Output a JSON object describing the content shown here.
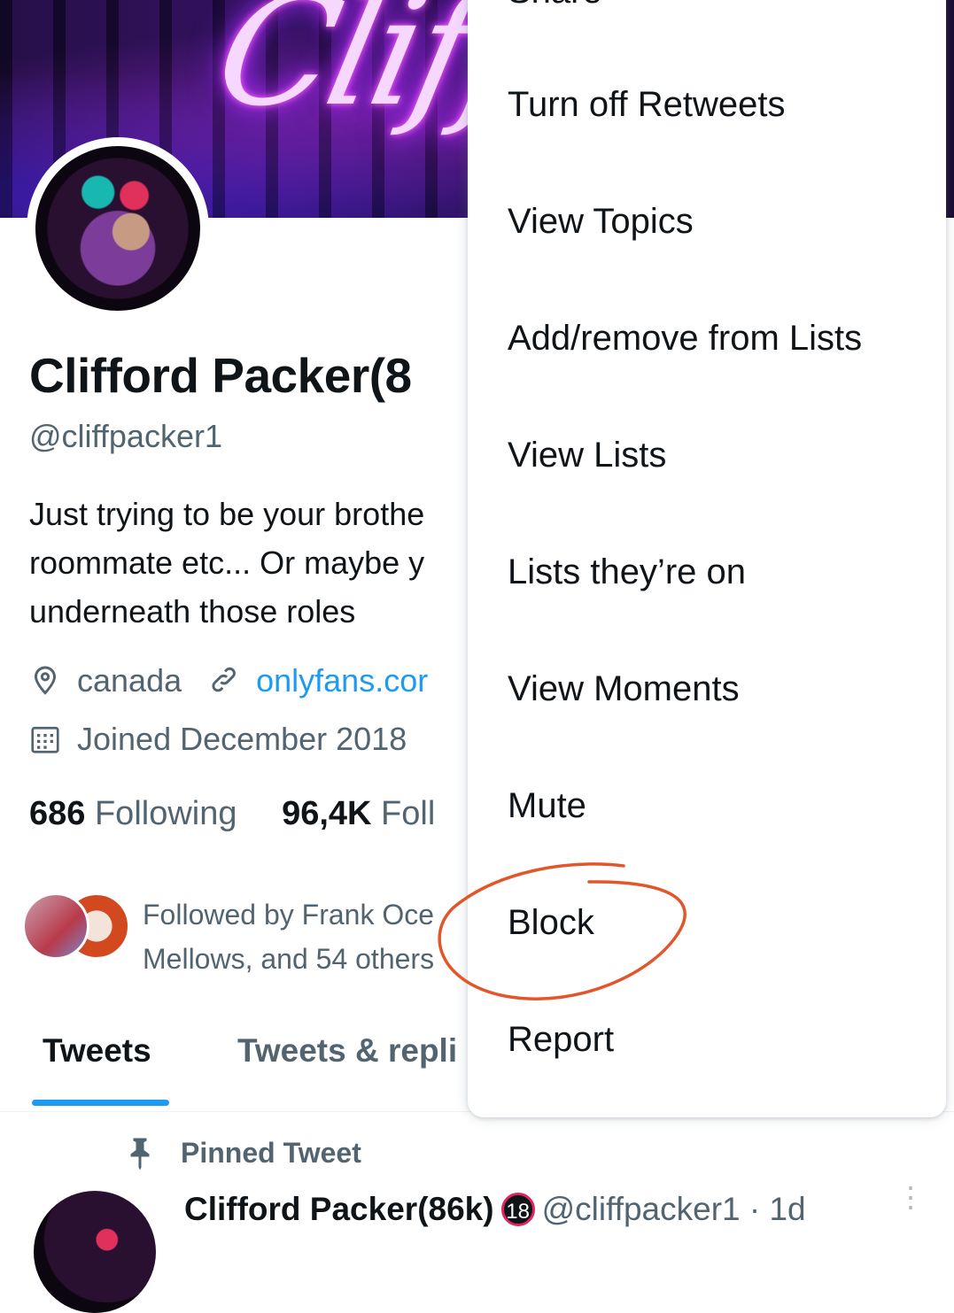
{
  "profile": {
    "name": "Clifford Packer(8",
    "handle": "@cliffpacker1",
    "bio_lines": [
      "Just trying to be your brothe",
      "roommate etc... Or maybe y",
      "underneath those roles"
    ],
    "location": "canada",
    "link": "onlyfans.cor",
    "joined": "Joined December 2018",
    "following_count": "686",
    "following_label": "Following",
    "followers_count": "96,4K",
    "followers_label": "Foll",
    "followed_by_lines": [
      "Followed by Frank Oce",
      "Mellows, and 54 others"
    ],
    "banner_text": "Cliffor"
  },
  "tabs": [
    {
      "label": "Tweets",
      "active": true
    },
    {
      "label": "Tweets & repli",
      "active": false
    }
  ],
  "pinned": {
    "label": "Pinned Tweet",
    "author_name": "Clifford Packer(86k)",
    "badge": "18",
    "author_handle_time": "@cliffpacker1 · 1d"
  },
  "menu": {
    "top_partial": "Share",
    "items": [
      "Turn off Retweets",
      "View Topics",
      "Add/remove from Lists",
      "View Lists",
      "Lists they’re on",
      "View Moments",
      "Mute",
      "Block",
      "Report"
    ],
    "highlighted": "Block",
    "annotation_color": "#e2562a"
  },
  "colors": {
    "accent": "#1d9bf0",
    "text": "#0f1419",
    "secondary": "#536471"
  }
}
